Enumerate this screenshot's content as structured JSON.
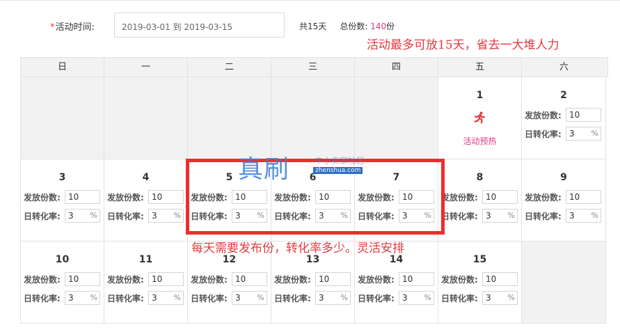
{
  "form": {
    "required_mark": "*",
    "time_label": "活动时间:",
    "date_range": "2019-03-01 到 2019-03-15",
    "total_days": "共15天",
    "total_label": "总份数:",
    "total_value": "140",
    "total_unit": "份"
  },
  "annotations": {
    "top": "活动最多可放15天，省去一大堆人力",
    "middle": "每天需要发布份，转化率多少。灵活安排"
  },
  "watermark": {
    "big": "真刷",
    "small": "中小卖家社区",
    "url": "zhenshua.com"
  },
  "colors": {
    "accent_red": "#e4393c",
    "highlight_red": "#ee2d2d",
    "pink": "#e0388a",
    "grid_gray": "#f2f2f2"
  },
  "labels": {
    "qty": "发放份数:",
    "rate": "日转化率:",
    "pct": "%",
    "preheat": "活动预热"
  },
  "weekdays": [
    "日",
    "一",
    "二",
    "三",
    "四",
    "五",
    "六"
  ],
  "weeks": [
    [
      {
        "empty": true
      },
      {
        "empty": true
      },
      {
        "empty": true
      },
      {
        "empty": true
      },
      {
        "empty": true
      },
      {
        "day": "1",
        "preheat": true
      },
      {
        "day": "2",
        "qty": "10",
        "rate": "3"
      }
    ],
    [
      {
        "day": "3",
        "qty": "10",
        "rate": "3"
      },
      {
        "day": "4",
        "qty": "10",
        "rate": "3"
      },
      {
        "day": "5",
        "qty": "10",
        "rate": "3"
      },
      {
        "day": "6",
        "qty": "10",
        "rate": "3"
      },
      {
        "day": "7",
        "qty": "10",
        "rate": "3"
      },
      {
        "day": "8",
        "qty": "10",
        "rate": "3"
      },
      {
        "day": "9",
        "qty": "10",
        "rate": "3"
      }
    ],
    [
      {
        "day": "10",
        "qty": "10",
        "rate": "3"
      },
      {
        "day": "11",
        "qty": "10",
        "rate": "3"
      },
      {
        "day": "12",
        "qty": "10",
        "rate": "3"
      },
      {
        "day": "13",
        "qty": "10",
        "rate": "3"
      },
      {
        "day": "14",
        "qty": "10",
        "rate": "3"
      },
      {
        "day": "15",
        "qty": "10",
        "rate": "3"
      },
      {
        "empty": true
      }
    ]
  ]
}
